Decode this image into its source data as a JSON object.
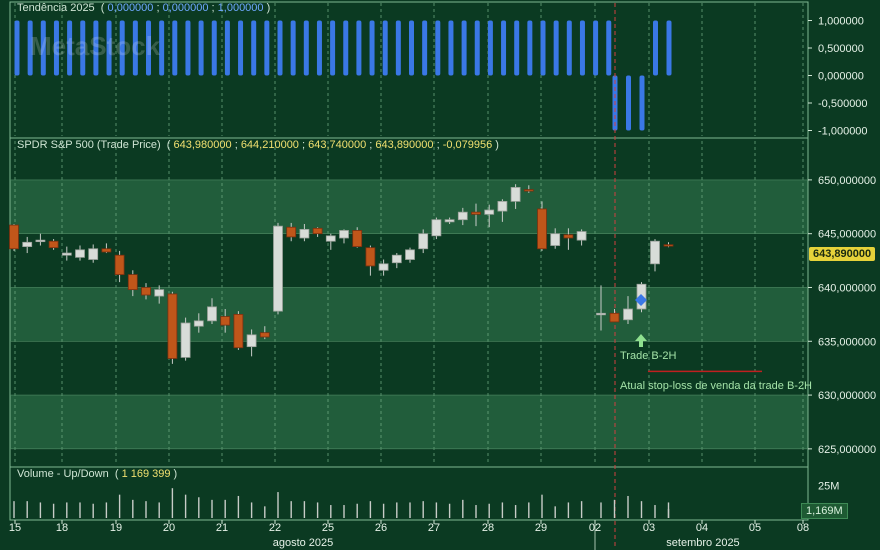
{
  "panels": {
    "trend": {
      "title": "Tendência 2025",
      "values": [
        "0,000000",
        "0,000000",
        "1,000000"
      ],
      "ticks": [
        "1,000000",
        "0,500000",
        "0,000000",
        "-0,500000",
        "-1,000000"
      ],
      "watermark": "MetaStock"
    },
    "price": {
      "title": "SPDR S&P 500 (Trade Price)",
      "values": [
        "643,980000",
        "644,210000",
        "643,740000",
        "643,890000",
        "-0,079956"
      ],
      "ticks": [
        "650,000000",
        "645,000000",
        "640,000000",
        "635,000000",
        "630,000000",
        "625,000000"
      ],
      "last_badge": "643,890000",
      "annotations": {
        "trade": "Trade B-2H",
        "stoploss": "Atual stop-loss de venda da trade B-2H"
      }
    },
    "volume": {
      "title": "Volume - Up/Down",
      "value": "1 169 399",
      "tick": "25M",
      "badge": "1,169M"
    }
  },
  "x_axis": {
    "days": [
      "15",
      "18",
      "19",
      "20",
      "21",
      "22",
      "25",
      "26",
      "27",
      "28",
      "29",
      "02",
      "03",
      "04",
      "05",
      "08"
    ],
    "months": [
      "agosto 2025",
      "setembro 2025"
    ]
  },
  "colors": {
    "background": "#0b3a22",
    "band_light": "#2a6a44",
    "up_candle": "#d8dcd8",
    "down_candle": "#c0561a",
    "trend_bar": "#3a78e6",
    "cursor_line": "#d04040",
    "stoploss_line": "#c02020"
  },
  "chart_data": {
    "type": "candlestick",
    "series": [
      {
        "name": "SPDR S&P 500 (Trade Price)",
        "candles": [
          {
            "o": 645.8,
            "h": 645.9,
            "l": 643.4,
            "c": 643.6
          },
          {
            "o": 643.8,
            "h": 644.7,
            "l": 643.2,
            "c": 644.2
          },
          {
            "o": 644.3,
            "h": 645.0,
            "l": 643.9,
            "c": 644.4
          },
          {
            "o": 644.3,
            "h": 644.5,
            "l": 643.5,
            "c": 643.7
          },
          {
            "o": 643.0,
            "h": 643.8,
            "l": 642.5,
            "c": 643.2
          },
          {
            "o": 642.8,
            "h": 643.9,
            "l": 642.5,
            "c": 643.5
          },
          {
            "o": 642.6,
            "h": 644.0,
            "l": 642.3,
            "c": 643.6
          },
          {
            "o": 643.6,
            "h": 644.1,
            "l": 643.2,
            "c": 643.3
          },
          {
            "o": 643.0,
            "h": 643.4,
            "l": 640.5,
            "c": 641.2
          },
          {
            "o": 641.2,
            "h": 641.6,
            "l": 639.2,
            "c": 639.8
          },
          {
            "o": 640.0,
            "h": 640.4,
            "l": 638.9,
            "c": 639.3
          },
          {
            "o": 639.2,
            "h": 640.2,
            "l": 638.5,
            "c": 639.8
          },
          {
            "o": 639.4,
            "h": 639.6,
            "l": 632.9,
            "c": 633.4
          },
          {
            "o": 633.5,
            "h": 637.2,
            "l": 633.2,
            "c": 636.7
          },
          {
            "o": 636.4,
            "h": 637.6,
            "l": 635.8,
            "c": 636.9
          },
          {
            "o": 636.9,
            "h": 639.0,
            "l": 636.6,
            "c": 638.2
          },
          {
            "o": 637.3,
            "h": 638.0,
            "l": 635.8,
            "c": 636.5
          },
          {
            "o": 637.5,
            "h": 637.8,
            "l": 634.2,
            "c": 634.4
          },
          {
            "o": 634.5,
            "h": 636.1,
            "l": 633.6,
            "c": 635.6
          },
          {
            "o": 635.8,
            "h": 636.4,
            "l": 635.2,
            "c": 635.4
          },
          {
            "o": 637.8,
            "h": 646.0,
            "l": 637.5,
            "c": 645.7
          },
          {
            "o": 645.6,
            "h": 646.0,
            "l": 644.3,
            "c": 644.7
          },
          {
            "o": 644.6,
            "h": 645.9,
            "l": 644.3,
            "c": 645.4
          },
          {
            "o": 645.5,
            "h": 645.6,
            "l": 644.7,
            "c": 645.0
          },
          {
            "o": 644.3,
            "h": 645.0,
            "l": 643.5,
            "c": 644.8
          },
          {
            "o": 644.6,
            "h": 645.4,
            "l": 644.1,
            "c": 645.3
          },
          {
            "o": 645.3,
            "h": 645.6,
            "l": 643.7,
            "c": 643.8
          },
          {
            "o": 643.7,
            "h": 643.9,
            "l": 641.1,
            "c": 642.0
          },
          {
            "o": 641.6,
            "h": 642.6,
            "l": 641.1,
            "c": 642.2
          },
          {
            "o": 642.3,
            "h": 643.2,
            "l": 641.8,
            "c": 643.0
          },
          {
            "o": 642.6,
            "h": 643.7,
            "l": 642.3,
            "c": 643.5
          },
          {
            "o": 643.6,
            "h": 645.4,
            "l": 643.2,
            "c": 645.0
          },
          {
            "o": 644.8,
            "h": 646.5,
            "l": 644.5,
            "c": 646.3
          },
          {
            "o": 646.1,
            "h": 646.5,
            "l": 645.9,
            "c": 646.3
          },
          {
            "o": 646.3,
            "h": 647.4,
            "l": 645.8,
            "c": 647.0
          },
          {
            "o": 647.0,
            "h": 647.8,
            "l": 645.7,
            "c": 646.8
          },
          {
            "o": 646.8,
            "h": 647.7,
            "l": 645.6,
            "c": 647.2
          },
          {
            "o": 647.1,
            "h": 648.2,
            "l": 646.1,
            "c": 648.0
          },
          {
            "o": 648.0,
            "h": 649.6,
            "l": 647.3,
            "c": 649.3
          },
          {
            "o": 649.1,
            "h": 649.5,
            "l": 648.8,
            "c": 649.0
          },
          {
            "o": 647.3,
            "h": 648.0,
            "l": 643.4,
            "c": 643.6
          },
          {
            "o": 643.9,
            "h": 645.5,
            "l": 643.6,
            "c": 645.0
          },
          {
            "o": 644.9,
            "h": 645.5,
            "l": 643.5,
            "c": 644.6
          },
          {
            "o": 644.4,
            "h": 645.4,
            "l": 643.9,
            "c": 645.2
          },
          {
            "o": 637.5,
            "h": 640.2,
            "l": 636.0,
            "c": 637.6
          },
          {
            "o": 637.6,
            "h": 638.0,
            "l": 636.8,
            "c": 636.8
          },
          {
            "o": 637.0,
            "h": 639.2,
            "l": 636.6,
            "c": 638.0
          },
          {
            "o": 638.0,
            "h": 640.5,
            "l": 637.7,
            "c": 640.3
          },
          {
            "o": 642.2,
            "h": 644.5,
            "l": 641.5,
            "c": 644.3
          },
          {
            "o": 643.98,
            "h": 644.21,
            "l": 643.74,
            "c": 643.89
          }
        ]
      }
    ],
    "trend_values": [
      1,
      1,
      1,
      1,
      1,
      1,
      1,
      1,
      1,
      1,
      1,
      1,
      1,
      1,
      1,
      1,
      1,
      1,
      1,
      1,
      1,
      1,
      1,
      1,
      1,
      1,
      1,
      1,
      1,
      1,
      1,
      1,
      1,
      1,
      1,
      1,
      1,
      1,
      1,
      1,
      1,
      1,
      1,
      1,
      1,
      1,
      -1,
      -1,
      -1,
      1,
      1
    ],
    "volume_values": [
      13,
      13,
      12,
      11,
      12,
      12,
      11,
      12,
      18,
      14,
      13,
      12,
      23,
      18,
      16,
      14,
      14,
      17,
      12,
      9,
      20,
      13,
      13,
      12,
      10,
      10,
      11,
      13,
      11,
      12,
      12,
      13,
      12,
      11,
      14,
      10,
      11,
      12,
      10,
      12,
      18,
      9,
      12,
      13,
      12,
      14,
      17,
      13,
      10,
      12,
      7
    ],
    "ylim_price": [
      623.5,
      652.5
    ],
    "ylim_trend": [
      -1.1,
      1.1
    ],
    "ylim_volume": [
      0,
      27
    ],
    "grid": true
  }
}
